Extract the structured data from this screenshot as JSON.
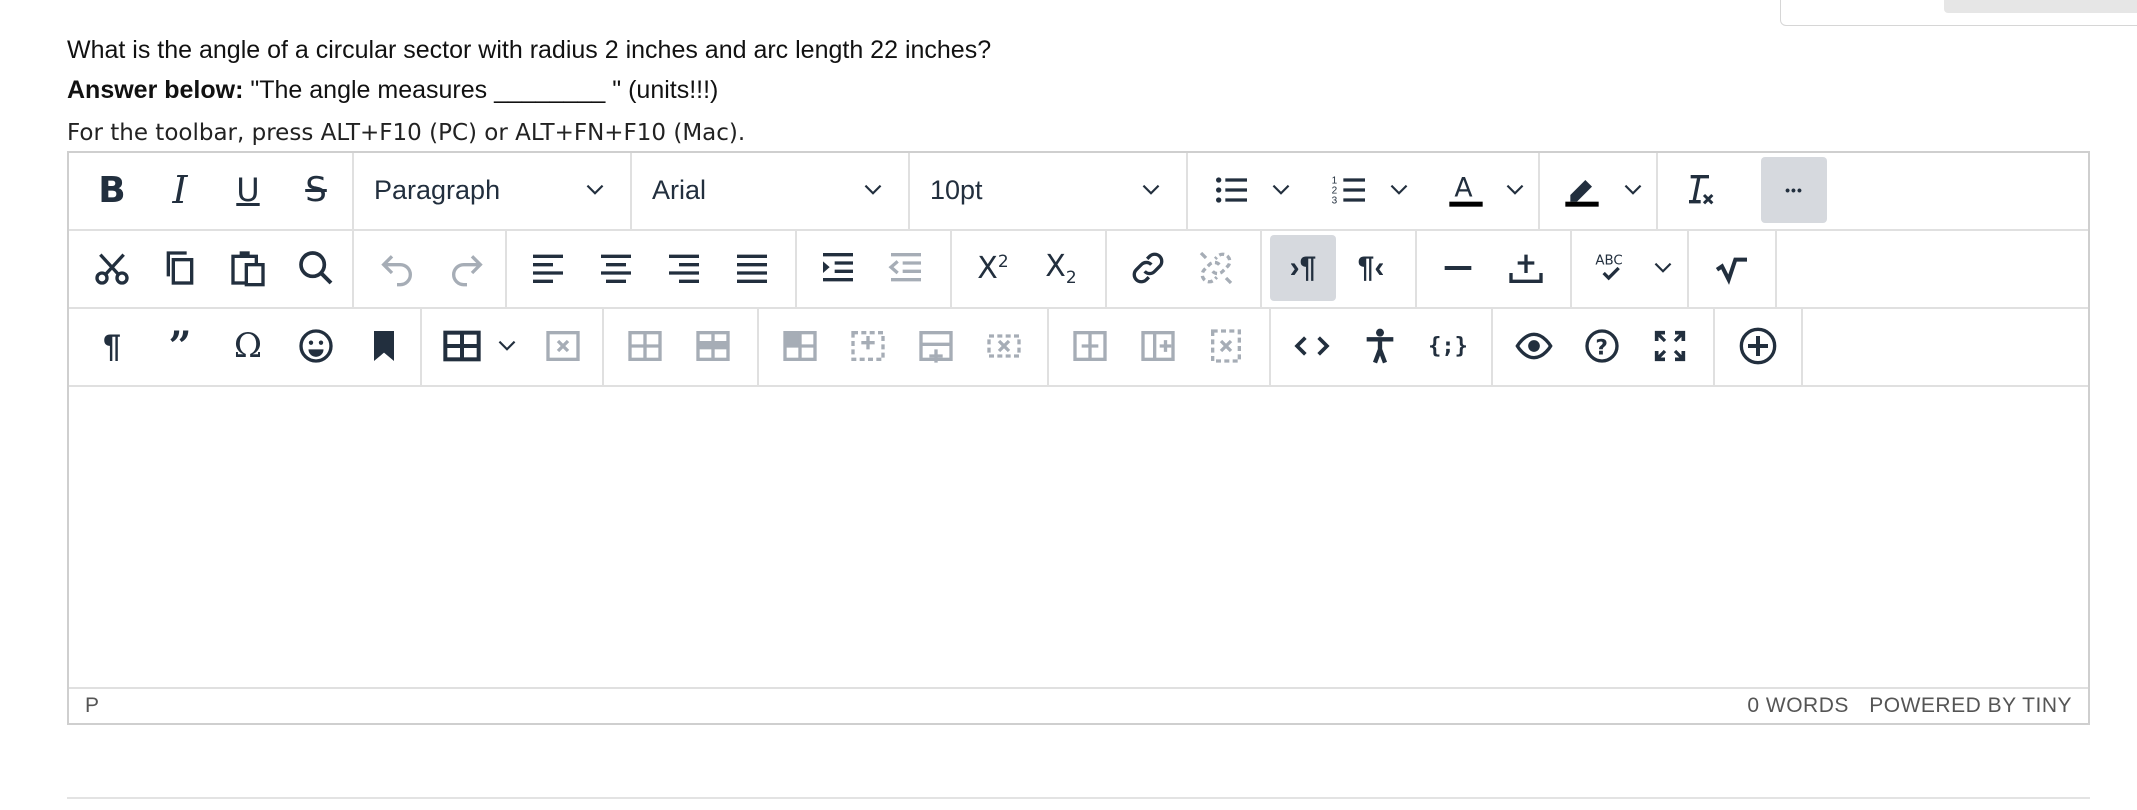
{
  "question": "What is the angle of a circular sector with radius 2 inches and arc length 22 inches?",
  "answer_label": "Answer below:",
  "answer_text": " \"The angle measures ________ \" (units!!!)",
  "toolbar_hint": "For the toolbar, press ALT+F10 (PC) or ALT+FN+F10 (Mac).",
  "toolbar": {
    "block_format": "Paragraph",
    "font_family": "Arial",
    "font_size": "10pt",
    "more_label": "•••"
  },
  "status": {
    "path": "P",
    "words": "0 WORDS",
    "powered": "POWERED BY TINY"
  },
  "colors": {
    "icon": "#222f3e",
    "icon_disabled": "#a6adb6",
    "active_bg": "#d6d9de",
    "border": "#cfcfcf"
  }
}
